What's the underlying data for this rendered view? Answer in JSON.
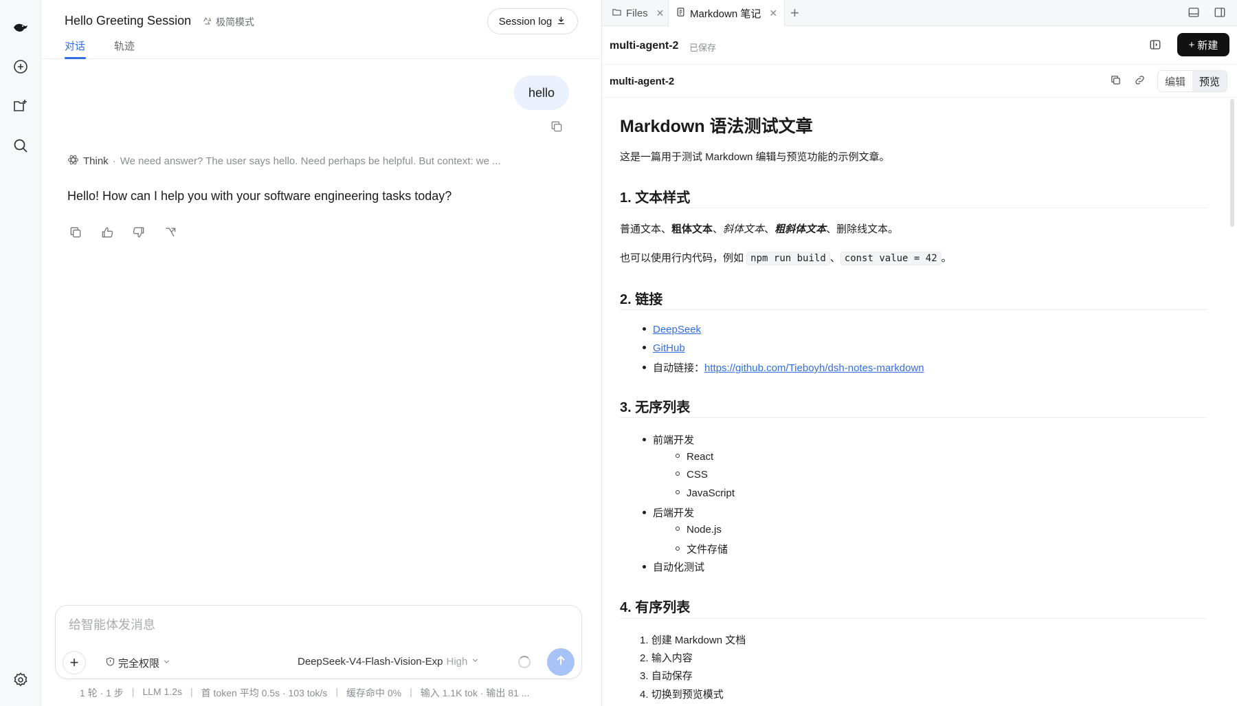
{
  "rail": {
    "icons": [
      "whale-logo-icon",
      "new-chat-icon",
      "new-project-icon",
      "search-icon",
      "settings-icon"
    ]
  },
  "chat": {
    "session_title": "Hello Greeting Session",
    "mode_label": "极简模式",
    "session_log_label": "Session log",
    "tabs": [
      {
        "label": "对话",
        "active": true
      },
      {
        "label": "轨迹",
        "active": false
      }
    ],
    "user_message": "hello",
    "think_label": "Think",
    "think_separator": "·",
    "think_preview": "We need answer? The user says hello. Need perhaps be helpful. But context: we ...",
    "assistant_message": "Hello! How can I help you with your software engineering tasks today?",
    "composer": {
      "placeholder": "给智能体发消息",
      "value": "",
      "permission_label": "完全权限",
      "model_name": "DeepSeek-V4-Flash-Vision-Exp",
      "effort": "High"
    },
    "stats": [
      "1 轮 · 1 步",
      "LLM 1.2s",
      "首 token 平均 0.5s · 103 tok/s",
      "缓存命中 0%",
      "输入 1.1K tok · 输出 81 ..."
    ]
  },
  "files": {
    "tabs": [
      {
        "label": "Files",
        "active": false
      },
      {
        "label": "Markdown 笔记",
        "active": true
      }
    ],
    "doc_title": "multi-agent-2",
    "saved_label": "已保存",
    "new_button": "新建",
    "sub_title": "multi-agent-2",
    "edit_label": "编辑",
    "preview_label": "预览"
  },
  "markdown": {
    "h1": "Markdown 语法测试文章",
    "intro": "这是一篇用于测试 Markdown 编辑与预览功能的示例文章。",
    "s1_title": "1. 文本样式",
    "s1_normal": "普通文本、",
    "s1_bold": "粗体文本",
    "s1_sep1": "、",
    "s1_italic": "斜体文本",
    "s1_sep2": "、",
    "s1_bolditalic": "粗斜体文本",
    "s1_sep3": "、删除线文本。",
    "s1_code_prefix": "也可以使用行内代码，例如 ",
    "s1_code1": "npm run build",
    "s1_code_sep": "、",
    "s1_code2": "const value = 42",
    "s1_code_suffix": "。",
    "s2_title": "2. 链接",
    "link1": "DeepSeek",
    "link2": "GitHub",
    "link3_prefix": "自动链接：",
    "link3": "https://github.com/Tieboyh/dsh-notes-markdown",
    "s3_title": "3. 无序列表",
    "ul_front": "前端开发",
    "ul_front_items": [
      "React",
      "CSS",
      "JavaScript"
    ],
    "ul_back": "后端开发",
    "ul_back_items": [
      "Node.js",
      "文件存储"
    ],
    "ul_test": "自动化测试",
    "s4_title": "4. 有序列表",
    "ol_items": [
      "创建 Markdown 文档",
      "输入内容",
      "自动保存",
      "切换到预览模式"
    ]
  }
}
